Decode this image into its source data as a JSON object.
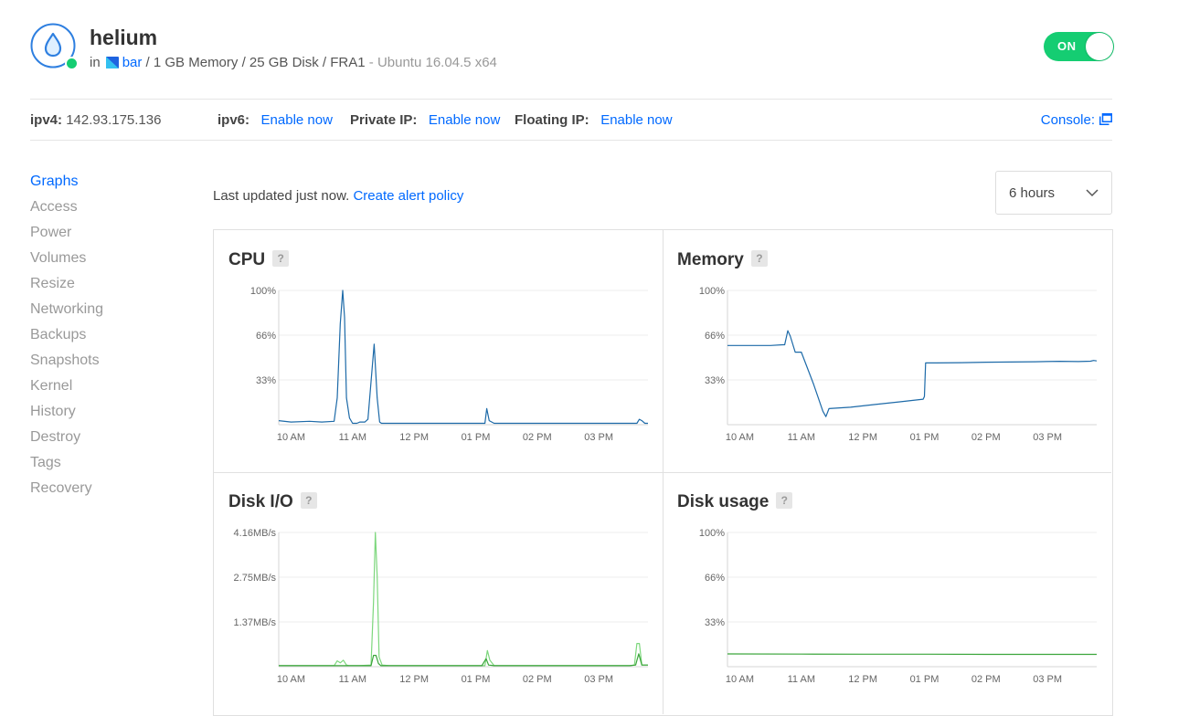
{
  "droplet": {
    "name": "helium",
    "in_label": "in",
    "project": "bar",
    "specs": " / 1 GB Memory / 25 GB Disk / FRA1",
    "os": " - Ubuntu 16.04.5 x64",
    "power_label": "ON",
    "status_color": "#15cd72"
  },
  "ipbar": {
    "ipv4_label": "ipv4:",
    "ipv4_value": "142.93.175.136",
    "ipv6_label": "ipv6:",
    "ipv6_action": "Enable now",
    "private_label": "Private IP:",
    "private_action": "Enable now",
    "floating_label": "Floating IP:",
    "floating_action": "Enable now",
    "console_label": "Console:"
  },
  "sidebar": {
    "items": [
      {
        "label": "Graphs",
        "active": true
      },
      {
        "label": "Access"
      },
      {
        "label": "Power"
      },
      {
        "label": "Volumes"
      },
      {
        "label": "Resize"
      },
      {
        "label": "Networking"
      },
      {
        "label": "Backups"
      },
      {
        "label": "Snapshots"
      },
      {
        "label": "Kernel"
      },
      {
        "label": "History"
      },
      {
        "label": "Destroy"
      },
      {
        "label": "Tags"
      },
      {
        "label": "Recovery"
      }
    ]
  },
  "graphs": {
    "updated_text": "Last updated just now.",
    "alert_link": "Create alert policy",
    "range_value": "6 hours",
    "help_glyph": "?"
  },
  "colors": {
    "accent": "#0069ff",
    "cpu_line": "#1d6aa8",
    "disk_line": "#7dd77d",
    "usage_line": "#3aa53a"
  },
  "chart_data": [
    {
      "id": "cpu",
      "type": "line",
      "title": "CPU",
      "x_ticks": [
        "10 AM",
        "11 AM",
        "12 PM",
        "01 PM",
        "02 PM",
        "03 PM"
      ],
      "y_ticks": [
        "33%",
        "66%",
        "100%"
      ],
      "ylim": [
        0,
        100
      ],
      "xlim": [
        9.8,
        15.8
      ],
      "grid": true,
      "series": [
        {
          "color": "#1d6aa8",
          "x": [
            9.8,
            10.0,
            10.3,
            10.5,
            10.7,
            10.75,
            10.8,
            10.84,
            10.87,
            10.9,
            10.95,
            11.0,
            11.07,
            11.12,
            11.2,
            11.25,
            11.35,
            11.4,
            11.44,
            11.47,
            11.5,
            11.55,
            11.7,
            12.0,
            12.3,
            12.6,
            12.9,
            13.15,
            13.18,
            13.22,
            13.3,
            13.6,
            14.0,
            14.4,
            14.8,
            15.2,
            15.45,
            15.62,
            15.66,
            15.7,
            15.75,
            15.8
          ],
          "y": [
            3,
            2,
            2.5,
            2,
            2.5,
            20,
            75,
            100,
            80,
            20,
            5,
            1,
            1,
            2,
            2,
            4,
            60,
            20,
            2,
            1,
            1,
            1,
            1,
            1,
            1,
            1,
            1,
            1,
            12,
            3,
            1,
            1,
            1,
            1,
            1,
            1,
            1,
            1,
            4,
            3,
            1,
            1
          ]
        }
      ]
    },
    {
      "id": "memory",
      "type": "line",
      "title": "Memory",
      "x_ticks": [
        "10 AM",
        "11 AM",
        "12 PM",
        "01 PM",
        "02 PM",
        "03 PM"
      ],
      "y_ticks": [
        "33%",
        "66%",
        "100%"
      ],
      "ylim": [
        0,
        100
      ],
      "xlim": [
        9.8,
        15.8
      ],
      "grid": true,
      "series": [
        {
          "color": "#1d6aa8",
          "x": [
            9.8,
            10.5,
            10.7,
            10.73,
            10.78,
            10.82,
            10.9,
            11.0,
            11.2,
            11.35,
            11.4,
            11.45,
            11.8,
            12.2,
            12.6,
            12.98,
            13.0,
            13.02,
            13.2,
            13.6,
            14.0,
            14.4,
            14.8,
            15.2,
            15.5,
            15.7,
            15.75,
            15.8
          ],
          "y": [
            59,
            59,
            59.5,
            59.5,
            70,
            66,
            54,
            54,
            30,
            10,
            6,
            12,
            13,
            15,
            17,
            19,
            21,
            46,
            46,
            46.2,
            46.5,
            46.7,
            46.9,
            47.2,
            47,
            47.3,
            47.8,
            47.5
          ]
        }
      ]
    },
    {
      "id": "disk-io",
      "type": "line",
      "title": "Disk I/O",
      "x_ticks": [
        "10 AM",
        "11 AM",
        "12 PM",
        "01 PM",
        "02 PM",
        "03 PM"
      ],
      "y_ticks": [
        "1.37MB/s",
        "2.75MB/s",
        "4.16MB/s"
      ],
      "ylim": [
        0,
        4.16
      ],
      "xlim": [
        9.8,
        15.8
      ],
      "grid": true,
      "series": [
        {
          "color": "#7dd77d",
          "x": [
            9.8,
            10.5,
            10.7,
            10.75,
            10.8,
            10.85,
            10.9,
            10.95,
            11.0,
            11.1,
            11.3,
            11.34,
            11.37,
            11.4,
            11.43,
            11.48,
            11.6,
            12.0,
            12.5,
            13.0,
            13.15,
            13.19,
            13.23,
            13.3,
            13.8,
            14.4,
            15.0,
            15.5,
            15.58,
            15.62,
            15.66,
            15.7,
            15.8
          ],
          "y": [
            0.03,
            0.03,
            0.03,
            0.18,
            0.12,
            0.2,
            0.05,
            0.03,
            0.03,
            0.03,
            0.05,
            2.0,
            4.16,
            2.8,
            0.3,
            0.05,
            0.03,
            0.03,
            0.03,
            0.03,
            0.03,
            0.5,
            0.2,
            0.03,
            0.03,
            0.03,
            0.03,
            0.03,
            0.05,
            0.72,
            0.72,
            0.05,
            0.05
          ]
        },
        {
          "color": "#3aa53a",
          "x": [
            9.8,
            11.3,
            11.34,
            11.38,
            11.42,
            11.46,
            11.6,
            13.1,
            13.17,
            13.21,
            13.3,
            15.5,
            15.6,
            15.65,
            15.7,
            15.8
          ],
          "y": [
            0.03,
            0.03,
            0.35,
            0.35,
            0.1,
            0.03,
            0.03,
            0.03,
            0.25,
            0.05,
            0.03,
            0.03,
            0.05,
            0.4,
            0.05,
            0.05
          ]
        }
      ]
    },
    {
      "id": "disk-usage",
      "type": "line",
      "title": "Disk usage",
      "x_ticks": [
        "10 AM",
        "11 AM",
        "12 PM",
        "01 PM",
        "02 PM",
        "03 PM"
      ],
      "y_ticks": [
        "33%",
        "66%",
        "100%"
      ],
      "ylim": [
        0,
        100
      ],
      "xlim": [
        9.8,
        15.8
      ],
      "grid": true,
      "series": [
        {
          "color": "#3aa53a",
          "x": [
            9.8,
            11.0,
            12.0,
            13.0,
            14.0,
            15.0,
            15.8
          ],
          "y": [
            9.5,
            9.4,
            9.3,
            9.3,
            9.2,
            9.2,
            9.2
          ]
        }
      ]
    }
  ]
}
